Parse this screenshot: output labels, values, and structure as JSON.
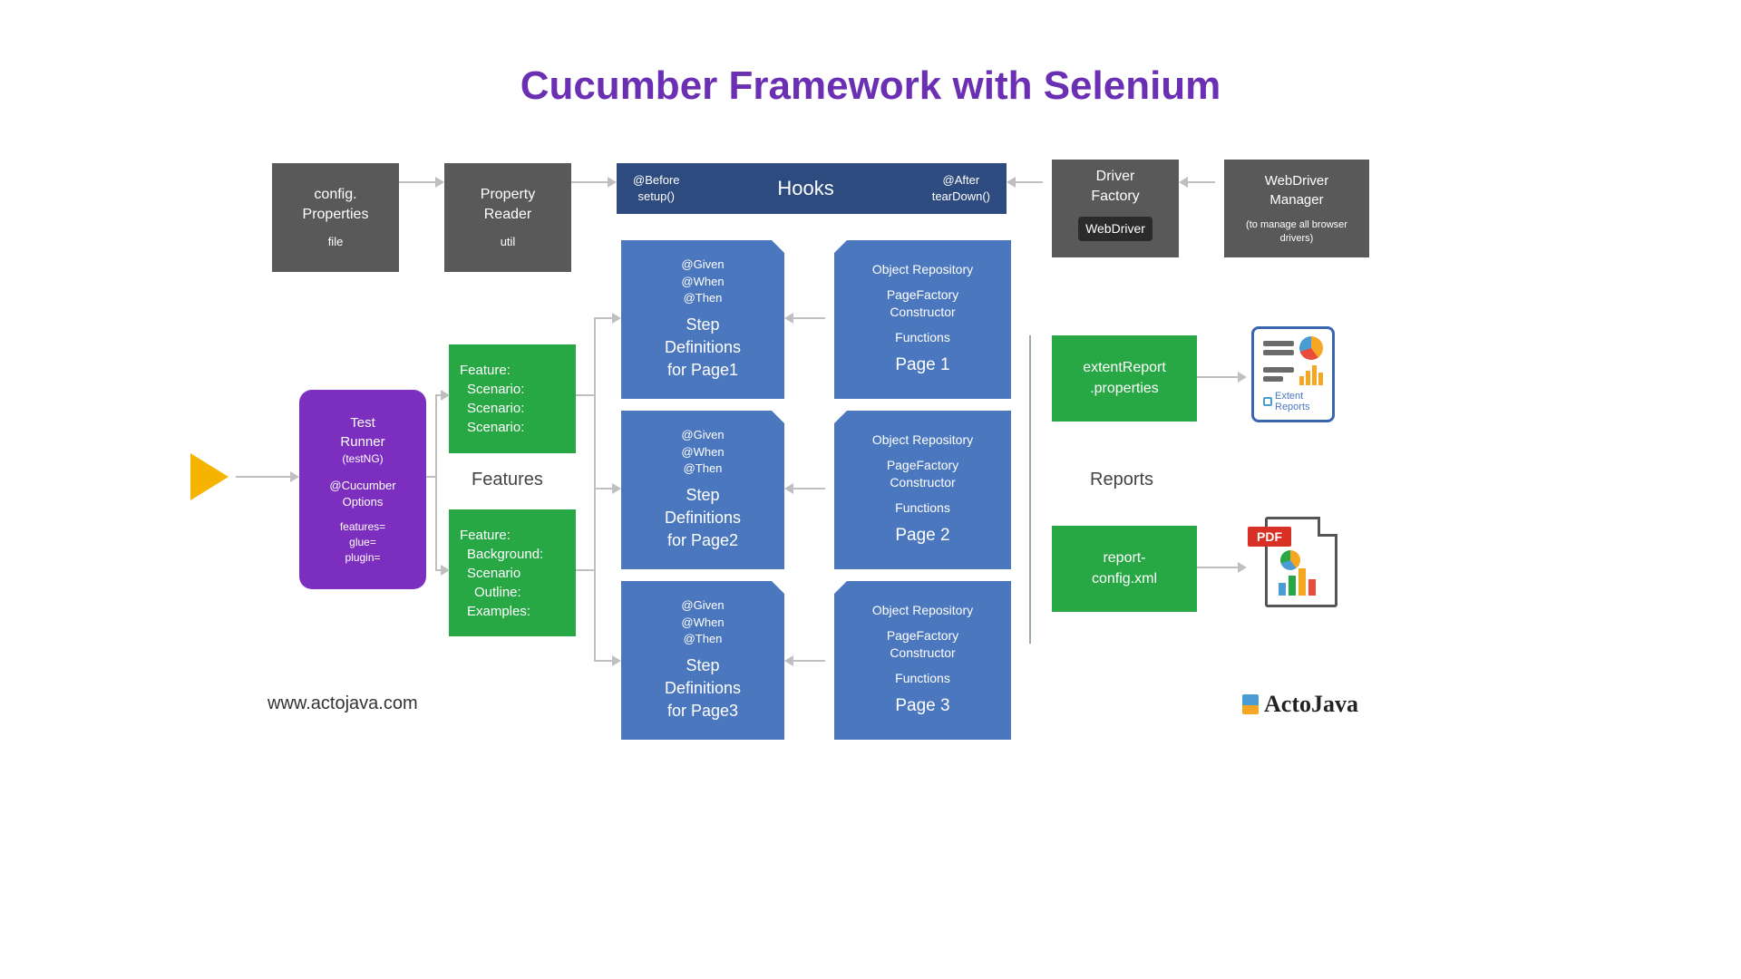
{
  "title": "Cucumber Framework with Selenium",
  "topRow": {
    "config": {
      "line1": "config.",
      "line2": "Properties",
      "sub": "file"
    },
    "property": {
      "line1": "Property",
      "line2": "Reader",
      "sub": "util"
    },
    "hooks": {
      "before1": "@Before",
      "before2": "setup()",
      "title": "Hooks",
      "after1": "@After",
      "after2": "tearDown()"
    },
    "driverFactory": {
      "line1": "Driver",
      "line2": "Factory",
      "chip": "WebDriver"
    },
    "wdm": {
      "line1": "WebDriver",
      "line2": "Manager",
      "sub": "(to manage all browser drivers)"
    }
  },
  "runner": {
    "l1": "Test",
    "l2": "Runner",
    "l3": "(testNG)",
    "l4": "@Cucumber",
    "l5": "Options",
    "l6": "features=",
    "l7": "glue=",
    "l8": "plugin="
  },
  "features": {
    "label": "Features",
    "box1": {
      "a": "Feature:",
      "b": "Scenario:",
      "c": "Scenario:",
      "d": "Scenario:"
    },
    "box2": {
      "a": "Feature:",
      "b": "Background:",
      "c": "Scenario",
      "d": "Outline:",
      "e": "Examples:"
    }
  },
  "steps": {
    "ann1": "@Given",
    "ann2": "@When",
    "ann3": "@Then",
    "t": "Step",
    "t2": "Definitions",
    "p1": "for Page1",
    "p2": "for Page2",
    "p3": "for Page3"
  },
  "pages": {
    "l1": "Object Repository",
    "l2": "PageFactory",
    "l3": "Constructor",
    "l4": "Functions",
    "p1": "Page 1",
    "p2": "Page 2",
    "p3": "Page 3"
  },
  "reports": {
    "label": "Reports",
    "box1a": "extentReport",
    "box1b": ".properties",
    "box2a": "report-",
    "box2b": "config.xml",
    "extentTag": "Extent",
    "extentTag2": "Reports",
    "pdf": "PDF"
  },
  "footer": {
    "url": "www.actojava.com",
    "brand": "ActoJava"
  }
}
